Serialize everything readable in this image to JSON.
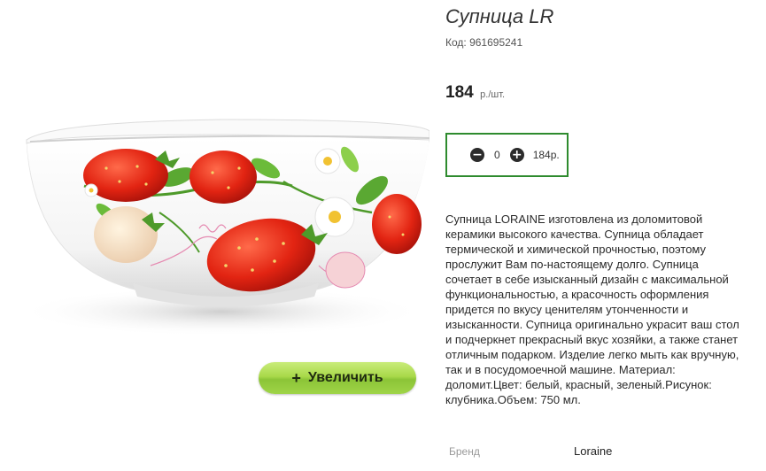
{
  "product": {
    "title": "Супница LR",
    "code": "Код: 961695241",
    "price": "184",
    "price_unit": "р./шт.",
    "description": "Супница LORAINE изготовлена из доломитовой\nкерамики высокого качества. Супница обладает\nтермической и химической прочностью, поэтому\nпрослужит Вам по-настоящему долго. Супница\nсочетает в себе изысканный дизайн с максимальной\nфункциональностью, а красочность оформления\nпридется по вкусу ценителям утонченности и\nизысканности. Супница оригинально украсит ваш стол\nи подчеркнет прекрасный вкус хозяйки, а также станет\nотличным подарком. Изделие легко мыть как вручную,\nтак и в посудомоечной машине. Материал:\nдоломит.Цвет: белый, красный, зеленый.Рисунок:\nклубника.Объем: 750 мл."
  },
  "quantity": {
    "value": "0",
    "total": "184р.",
    "decrement_icon": "minus-circle-icon",
    "increment_icon": "plus-circle-icon"
  },
  "gallery": {
    "zoom_label": "Увеличить",
    "zoom_icon": "plus-icon"
  },
  "attributes": {
    "brand_label": "Бренд",
    "brand_value": "Loraine"
  },
  "colors": {
    "accent_border": "#2e8b2e",
    "zoom_button": "#a9d94a"
  }
}
